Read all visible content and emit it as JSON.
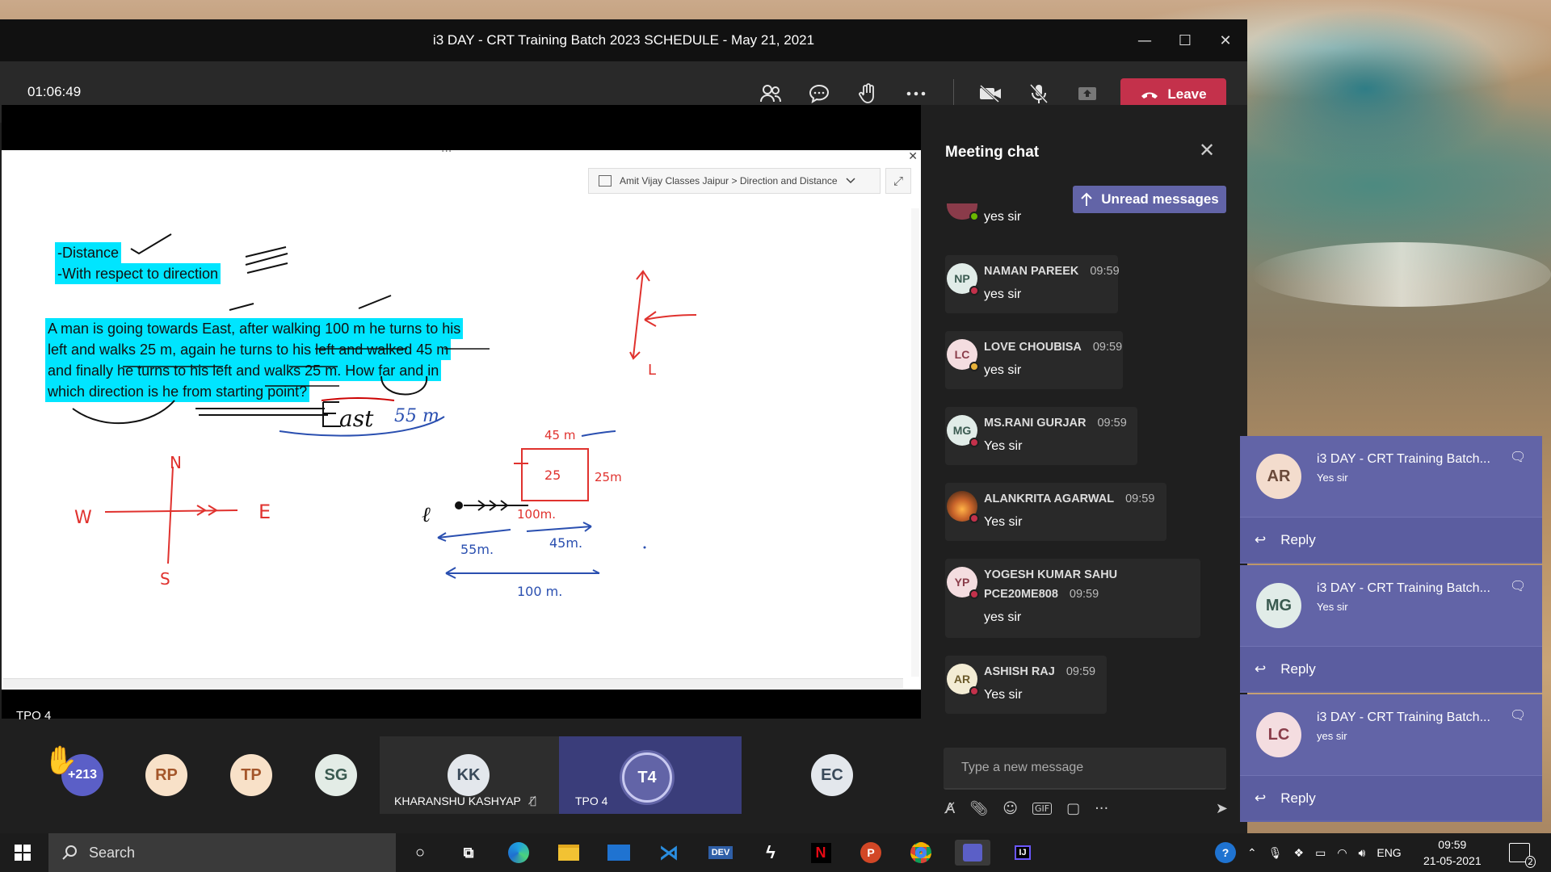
{
  "window": {
    "title": "i3 DAY - CRT Training Batch 2023 SCHEDULE - May 21, 2021",
    "minimize": "—",
    "maximize": "☐",
    "close": "✕"
  },
  "toolbar": {
    "timer": "01:06:49",
    "leave_label": "Leave",
    "icons": [
      "participants-icon",
      "chat-icon",
      "raise-hand-icon",
      "more-icon",
      "camera-off-icon",
      "mic-off-icon",
      "share-icon"
    ]
  },
  "share": {
    "breadcrumb": "Amit Vijay Classes Jaipur > Direction and Distance",
    "line1": "-Distance",
    "line2": "-With respect to direction",
    "question": [
      "A man is going towards East, after walking 100 m he turns to his",
      "left and walks 25 m, again he turns to his left and walked 45 m",
      "and finally he turns to his left and walks 25 m. How far and in",
      "which direction is he from starting point?"
    ],
    "presenter_label": "TPO 4"
  },
  "participants": {
    "overflow_count": "+213",
    "initials": [
      "RP",
      "TP",
      "SG",
      "KK",
      "T4",
      "EC"
    ],
    "tile_kk_name": "KHARANSHU KASHYAP",
    "tile_t4_name": "TPO 4"
  },
  "chat": {
    "header": "Meeting chat",
    "unread_label": "Unread messages",
    "first_text": "yes sir",
    "messages": [
      {
        "initials": "NP",
        "name": "NAMAN PAREEK",
        "time": "09:59",
        "text": "yes sir",
        "avatar_bg": "#e1ece8",
        "avatar_fg": "#3a5a50",
        "status": "#c4314b"
      },
      {
        "initials": "LC",
        "name": "LOVE CHOUBISA",
        "time": "09:59",
        "text": "yes sir",
        "avatar_bg": "#f4dde0",
        "avatar_fg": "#8a3d4a",
        "status": "#e8b13a"
      },
      {
        "initials": "MG",
        "name": "MS.RANI GURJAR",
        "time": "09:59",
        "text": "Yes sir",
        "avatar_bg": "#e1ece8",
        "avatar_fg": "#3a5a50",
        "status": "#c4314b"
      },
      {
        "initials": "",
        "name": "ALANKRITA AGARWAL",
        "time": "09:59",
        "text": "Yes sir",
        "avatar_bg": "#c8632a",
        "avatar_fg": "#fff",
        "status": "#c4314b"
      },
      {
        "initials": "YP",
        "name": "YOGESH KUMAR SAHU",
        "name2": "PCE20ME808",
        "time": "09:59",
        "text": "yes sir",
        "avatar_bg": "#f4dde0",
        "avatar_fg": "#8a3d4a",
        "status": "#c4314b"
      },
      {
        "initials": "AR",
        "name": "ASHISH RAJ",
        "time": "09:59",
        "text": "Yes sir",
        "avatar_bg": "#f3ecd4",
        "avatar_fg": "#6b5a2a",
        "status": "#c4314b"
      }
    ],
    "compose_placeholder": "Type a new message"
  },
  "toasts": [
    {
      "initials": "AR",
      "title": "i3 DAY - CRT Training Batch...",
      "body": "Yes sir",
      "reply": "Reply"
    },
    {
      "initials": "MG",
      "title": "i3 DAY - CRT Training Batch...",
      "body": "Yes sir",
      "reply": "Reply"
    },
    {
      "initials": "LC",
      "title": "i3 DAY - CRT Training Batch...",
      "body": "yes sir",
      "reply": "Reply"
    }
  ],
  "taskbar": {
    "search_label": "Search",
    "apps": [
      "task-view",
      "edge",
      "file-explorer",
      "mail",
      "vscode",
      "dev",
      "netflix",
      "powerpoint",
      "chrome",
      "teams",
      "jetbrains"
    ],
    "dev_label": "DEV",
    "netflix_label": "N",
    "ppt_label": "P",
    "ij_label": "IJ",
    "lang": "ENG",
    "time": "09:59",
    "date": "21-05-2021",
    "notif_count": "2"
  }
}
